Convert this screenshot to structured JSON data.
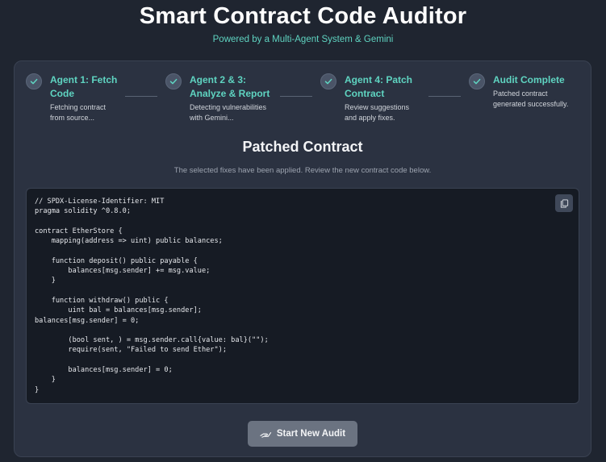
{
  "header": {
    "title": "Smart Contract Code Auditor",
    "subtitle": "Powered by a Multi-Agent System & Gemini"
  },
  "steps": [
    {
      "title_line1": "Agent 1: Fetch",
      "title_line2": "Code",
      "desc_line1": "Fetching contract",
      "desc_line2": "from source...",
      "icon": "check-circle-icon"
    },
    {
      "title_line1": "Agent 2 & 3:",
      "title_line2": "Analyze & Report",
      "desc_line1": "Detecting vulnerabilities",
      "desc_line2": "with Gemini...",
      "icon": "check-circle-icon"
    },
    {
      "title_line1": "Agent 4: Patch",
      "title_line2": "Contract",
      "desc_line1": "Review suggestions",
      "desc_line2": "and apply fixes.",
      "icon": "check-circle-icon"
    },
    {
      "title_line1": "Audit Complete",
      "title_line2": "",
      "desc_line1": "Patched contract",
      "desc_line2": "generated successfully.",
      "icon": "check-circle-icon"
    }
  ],
  "result": {
    "title": "Patched Contract",
    "description": "The selected fixes have been applied. Review the new contract code below.",
    "copy_icon": "copy-icon"
  },
  "code": "// SPDX-License-Identifier: MIT\npragma solidity ^0.8.0;\n\ncontract EtherStore {\n    mapping(address => uint) public balances;\n\n    function deposit() public payable {\n        balances[msg.sender] += msg.value;\n    }\n\n    function withdraw() public {\n        uint bal = balances[msg.sender];\nbalances[msg.sender] = 0;\n\n        (bool sent, ) = msg.sender.call{value: bal}(\"\");\n        require(sent, \"Failed to send Ether\");\n\n        balances[msg.sender] = 0;\n    }\n}",
  "actions": {
    "new_audit_label": "Start New Audit",
    "new_audit_icon": "hand-icon"
  },
  "colors": {
    "accent": "#5fd4c1",
    "background": "#1f2530",
    "card": "#2b3241",
    "code_bg": "#161b24"
  }
}
